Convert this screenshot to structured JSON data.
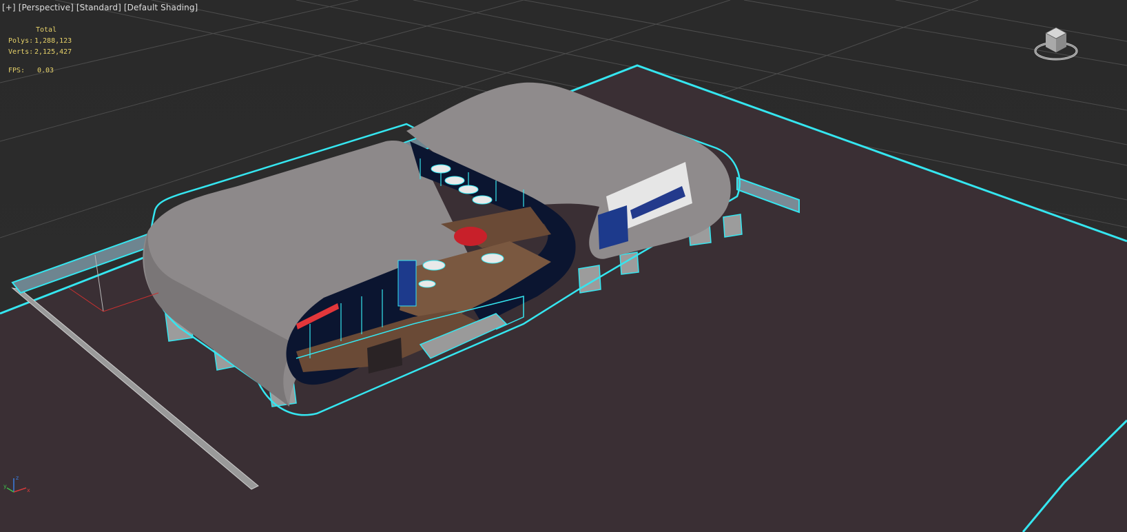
{
  "viewport": {
    "labels": [
      "[+]",
      "[Perspective]",
      "[Standard]",
      "[Default Shading]"
    ]
  },
  "stats": {
    "header": "Total",
    "polys_label": "Polys:",
    "polys_value": "1,288,123",
    "verts_label": "Verts:",
    "verts_value": "2,125,427",
    "fps_label": "FPS:",
    "fps_value": "0.03"
  },
  "colors": {
    "grid": "#4a4a4a",
    "ground": "#3a2f33",
    "selection_outline": "#35e6f0",
    "roof": "#8f8b8c",
    "frame": "#0b1530",
    "floor": "#6b4a36"
  },
  "icons": {
    "viewcube": "viewcube-icon",
    "tripod": "axis-tripod-icon"
  }
}
